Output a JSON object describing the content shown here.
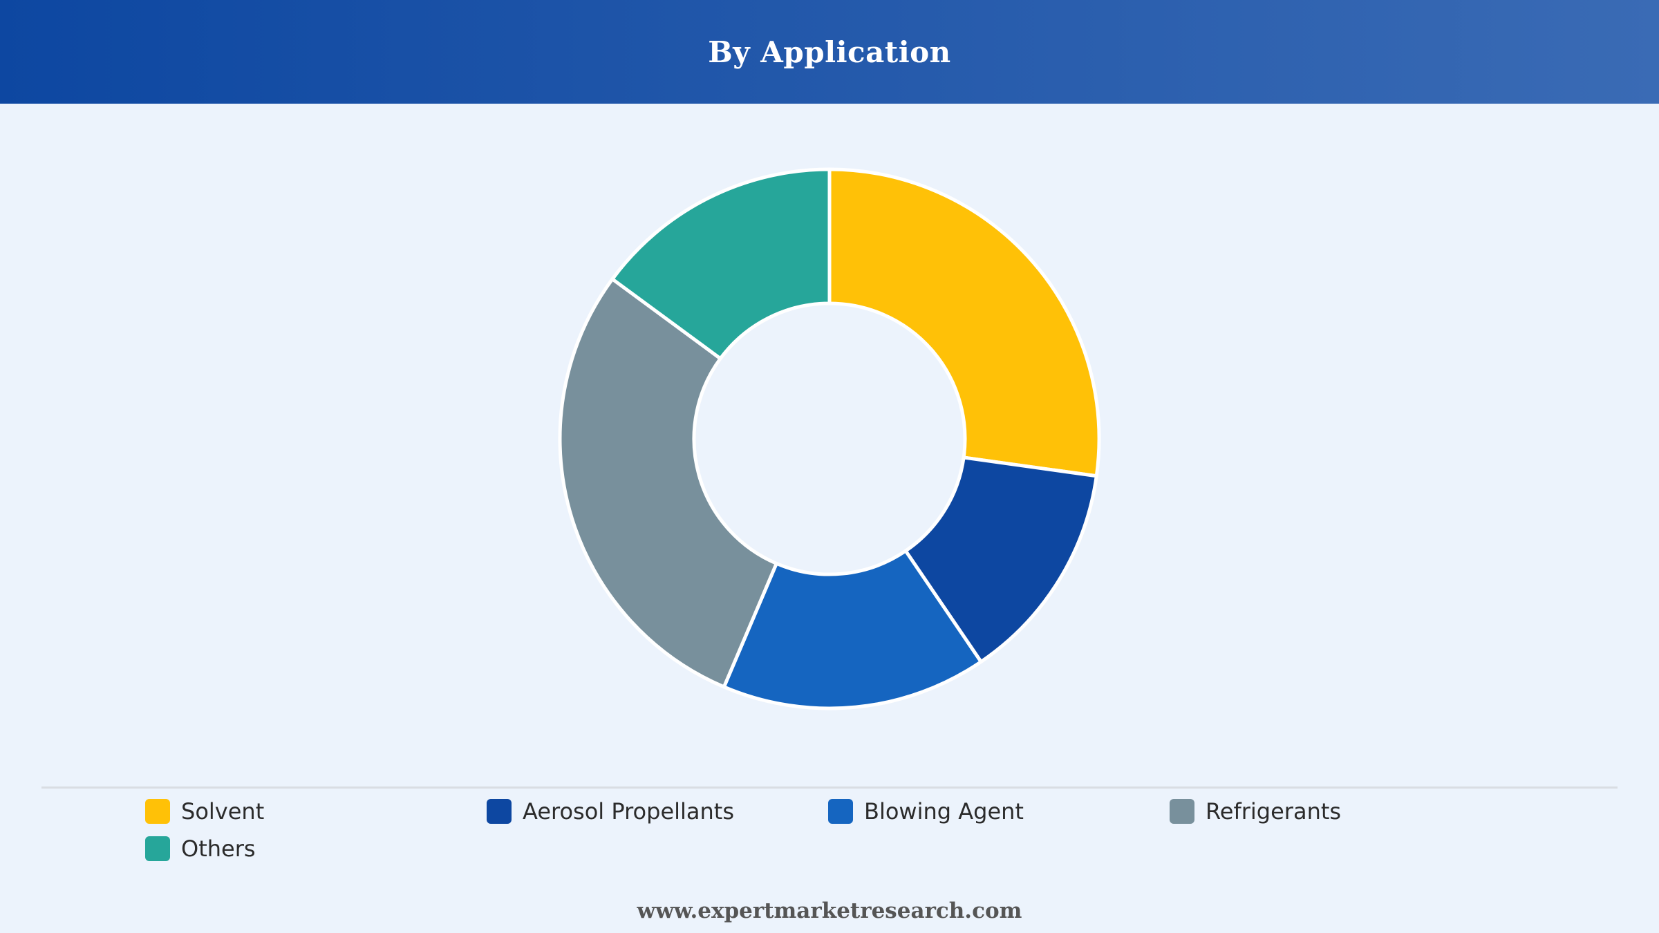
{
  "header": {
    "title": "By Application"
  },
  "chart_data": {
    "type": "pie",
    "donut": true,
    "title": "By Application",
    "categories": [
      "Solvent",
      "Aerosol Propellants",
      "Blowing Agent",
      "Refrigerants",
      "Others"
    ],
    "values": [
      27.2,
      13.3,
      15.9,
      28.7,
      14.9
    ],
    "colors": [
      "#ffc107",
      "#0d47a1",
      "#1565c0",
      "#78909c",
      "#26a69a"
    ],
    "legend_position": "bottom"
  },
  "footer": {
    "source": "www.expertmarketresearch.com"
  }
}
